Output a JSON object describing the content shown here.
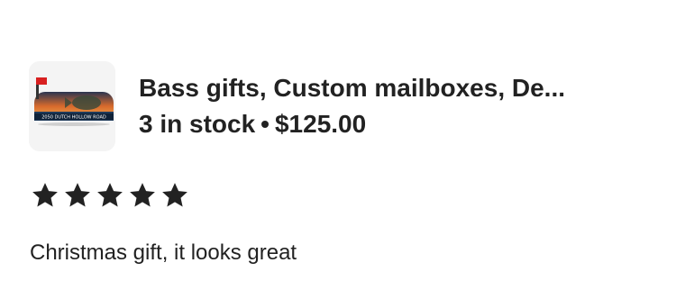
{
  "product": {
    "title": "Bass gifts, Custom mailboxes, De...",
    "stock": "3 in stock",
    "separator": "•",
    "price": "$125.00",
    "thumbnail_icon": "mailbox-product-thumbnail",
    "thumbnail_caption": "2050 DUTCH HOLLOW ROAD"
  },
  "review": {
    "rating": 5,
    "rating_max": 5,
    "star_icon": "star-icon",
    "star_color": "#222222",
    "text": "Christmas gift, it looks great"
  }
}
